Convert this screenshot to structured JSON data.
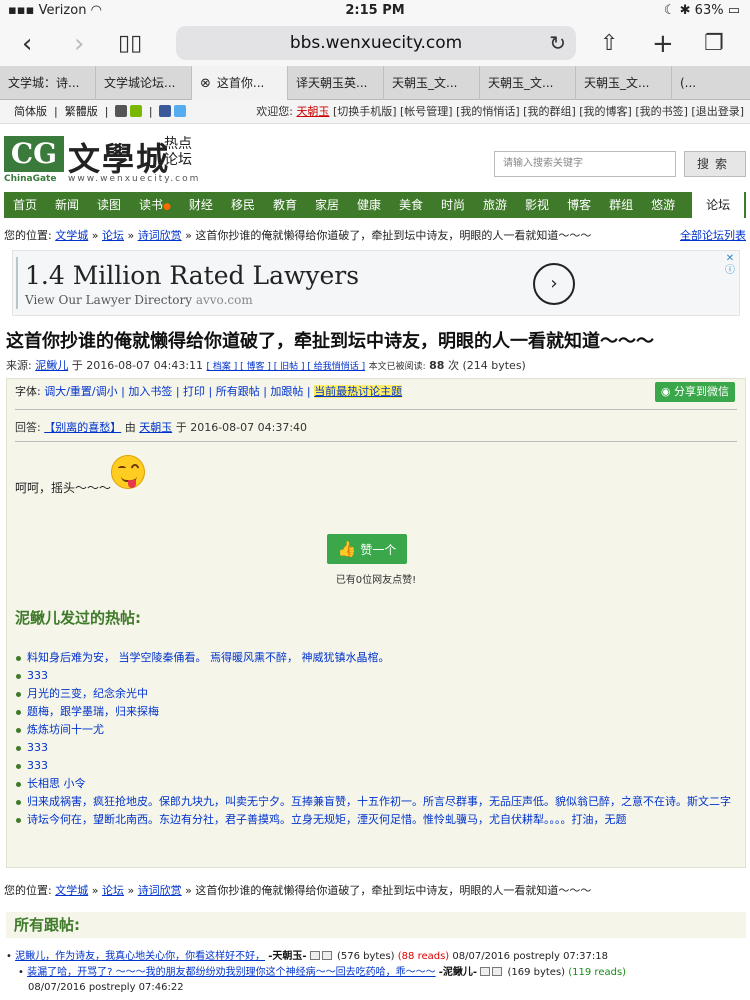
{
  "statusbar": {
    "carrier": "Verizon",
    "time": "2:15 PM",
    "battery": "63%"
  },
  "browser": {
    "url": "bbs.wenxuecity.com",
    "tabs": [
      {
        "label": "文学城：诗..."
      },
      {
        "label": "文学城论坛..."
      },
      {
        "label": "这首你..."
      },
      {
        "label": "译天朝玉英..."
      },
      {
        "label": "天朝玉_文..."
      },
      {
        "label": "天朝玉_文..."
      },
      {
        "label": "天朝玉_文..."
      },
      {
        "label": "(..."
      }
    ]
  },
  "toplinks": {
    "simplified": "简体版",
    "traditional": "繁體版",
    "welcome": "欢迎您:",
    "username": "天朝玉",
    "links": "[切换手机版] [帐号管理] [我的悄悄话] [我的群组] [我的博客] [我的书签] [退出登录]"
  },
  "logo": {
    "cg": "CG",
    "name": "文學城",
    "sub1": "热点",
    "sub2": "论坛",
    "tag": "ChinaGate",
    "url": "www.wenxuecity.com"
  },
  "search": {
    "placeholder": "请输入搜索关键字",
    "button": "搜索"
  },
  "nav": {
    "items": [
      "首页",
      "新闻",
      "读图",
      "读书",
      "财经",
      "移民",
      "教育",
      "家居",
      "健康",
      "美食",
      "时尚",
      "旅游",
      "影视",
      "博客",
      "群组",
      "悠游"
    ],
    "active": "论坛"
  },
  "breadcrumb": {
    "label": "您的位置:",
    "l1": "文学城",
    "l2": "论坛",
    "l3": "诗词欣赏",
    "tail": "这首你抄谁的俺就懒得给你道破了，牵扯到坛中诗友，明眼的人一看就知道～～～",
    "all_forums": "全部论坛列表"
  },
  "ad": {
    "title": "1.4 Million Rated Lawyers",
    "sub": "View Our Lawyer Directory",
    "domain": "avvo.com",
    "arrow": "›",
    "badge": "✕"
  },
  "post": {
    "title": "这首你抄谁的俺就懒得给你道破了，牵扯到坛中诗友，明眼的人一看就知道～～～",
    "meta_source": "来源:",
    "author": "泥鳅儿",
    "at": "于",
    "datetime": "2016-08-07 04:43:11",
    "meta_links": "[ 档案 ] [ 博客 ] [ 旧帖 ] [ 给我悄悄话 ]",
    "read_label": "本文已被阅读:",
    "reads": "88",
    "reads_unit": "次 (214 bytes)",
    "tools_label": "字体:",
    "tools_links": "调大/重置/调小 | 加入书签 | 打印 | 所有跟帖 | 加跟帖 |",
    "hot_topic": "当前最热讨论主题",
    "share": "分享到微信",
    "reply_label": "回答:",
    "reply_link": "【别离的喜愁】",
    "reply_by": "由",
    "reply_user": "天朝玉",
    "reply_at": "于 2016-08-07 04:37:40",
    "body": "呵呵，摇头～～～",
    "like_button": "赞一个",
    "like_count": "已有0位网友点赞!"
  },
  "hot": {
    "title": "泥鳅儿发过的热帖:",
    "items": [
      "料知身后难为安， 当学空陵秦俑看。 焉得暖风熏不醉， 神威犹镇水晶棺。",
      "333",
      "月光的三变，纪念余光中",
      "题梅，跟学墨瑞，归来探梅",
      "炼炼坊间十一尤",
      "333",
      "333",
      "长相思 小令",
      "归来成祸害，疯狂抢地皮。保郎九块九，叫卖无宁夕。互捧兼盲赞，十五作初一。所言尽群事，无品压声低。貌似翁已醉，之意不在诗。斯文二字",
      "诗坛今何在，望断北南西。东边有分社，君子善摸鸡。立身无规矩，湮灭何足惜。惟怜虬骥马，尤自伏耕犁。。。。打油，无题"
    ]
  },
  "followups": {
    "title": "所有跟帖:",
    "f1_link": "泥鳅儿，作为诗友，我真心地关心你，你看这样好不好，",
    "f1_author": "-天朝玉-",
    "f1_bytes": "(576 bytes)",
    "f1_reads": "(88 reads)",
    "f1_date": "08/07/2016 postreply 07:37:18",
    "f2_link": "装漏了哈，开骂了? ～～～我的朋友都纷纷劝我别理你这个神经病～～回去吃药哈，乖～～～",
    "f2_author": "-泥鳅儿-",
    "f2_bytes": "(169 bytes)",
    "f2_reads": "(119 reads)",
    "f2_date": "08/07/2016 postreply 07:46:22"
  }
}
